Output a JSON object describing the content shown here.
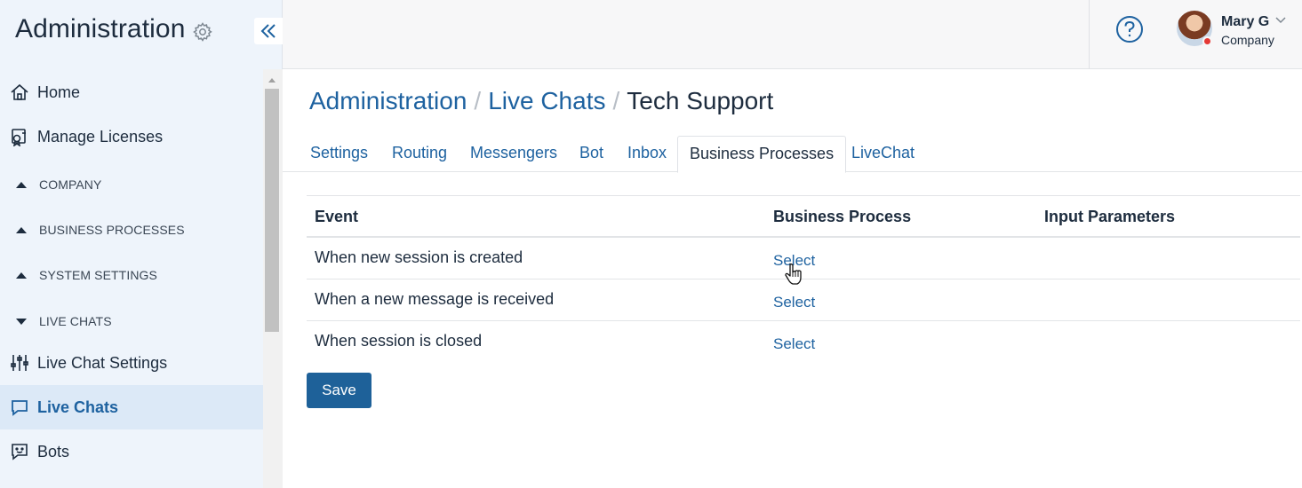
{
  "sidebar": {
    "title": "Administration",
    "items": [
      {
        "label": "Home",
        "icon": "home-icon"
      },
      {
        "label": "Manage Licenses",
        "icon": "licenses-icon"
      },
      {
        "label": "Live Chat Settings",
        "icon": "sliders-icon"
      },
      {
        "label": "Live Chats",
        "icon": "chat-icon",
        "active": true
      },
      {
        "label": "Bots",
        "icon": "bot-icon"
      }
    ],
    "sections": [
      {
        "label": "COMPANY",
        "expanded": false
      },
      {
        "label": "BUSINESS PROCESSES",
        "expanded": false
      },
      {
        "label": "SYSTEM SETTINGS",
        "expanded": false
      },
      {
        "label": "LIVE CHATS",
        "expanded": true
      }
    ]
  },
  "header": {
    "user": {
      "name": "Mary G",
      "company": "Company",
      "status_color": "#e53935"
    }
  },
  "breadcrumb": [
    {
      "label": "Administration",
      "link": true
    },
    {
      "label": "Live Chats",
      "link": true
    },
    {
      "label": "Tech Support",
      "link": false
    }
  ],
  "tabs": [
    {
      "label": "Settings"
    },
    {
      "label": "Routing"
    },
    {
      "label": "Messengers"
    },
    {
      "label": "Bot"
    },
    {
      "label": "Inbox"
    },
    {
      "label": "Business Processes",
      "active": true
    },
    {
      "label": "LiveChat"
    }
  ],
  "table": {
    "columns": [
      "Event",
      "Business Process",
      "Input Parameters"
    ],
    "rows": [
      {
        "event": "When new session is created",
        "process": "Select",
        "params": ""
      },
      {
        "event": "When a new message is received",
        "process": "Select",
        "params": ""
      },
      {
        "event": "When session is closed",
        "process": "Select",
        "params": ""
      }
    ]
  },
  "save_label": "Save",
  "colors": {
    "accent": "#1e62a0",
    "button": "#1e6199",
    "sidebar_bg": "#eef4fb",
    "active_item_bg": "#dce9f7"
  }
}
